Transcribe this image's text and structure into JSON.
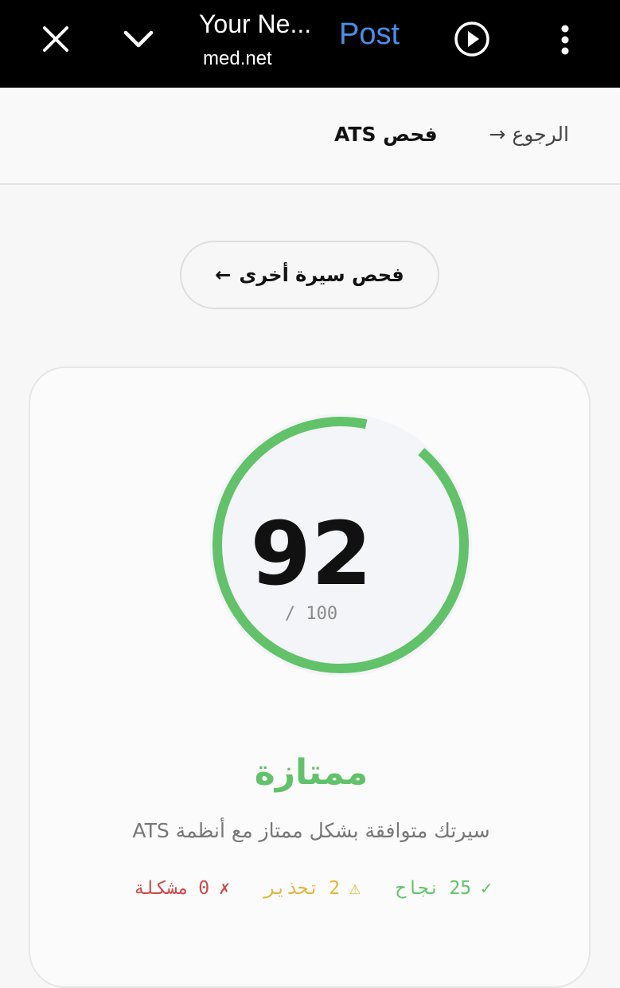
{
  "browser": {
    "title": "Your Ne...",
    "url": "med.net",
    "post_label": "Post",
    "icons": [
      "close-icon",
      "chevron-down-icon",
      "play-icon",
      "more-vertical-icon"
    ]
  },
  "header": {
    "back_label": "الرجوع",
    "back_arrow": "→",
    "title": "فحص ATS"
  },
  "actions": {
    "check_another_label": "فحص سيرة أخرى",
    "check_another_arrow": "←"
  },
  "result": {
    "score": "92",
    "max": "/ 100",
    "score_fraction": 0.92,
    "rating": "ممتازة",
    "description": "سيرتك متوافقة بشكل ممتاز مع أنظمة ATS",
    "stats": {
      "pass": {
        "icon": "✓",
        "count": "25",
        "label": "نجاح"
      },
      "warn": {
        "icon": "⚠",
        "count": "2",
        "label": "تحذير"
      },
      "error": {
        "icon": "✗",
        "count": "0",
        "label": "مشكلة"
      }
    }
  },
  "colors": {
    "accent_green": "#62c26a",
    "warning": "#e0b63b",
    "error": "#cc4b4b",
    "browser_post": "#4a8ee8"
  }
}
